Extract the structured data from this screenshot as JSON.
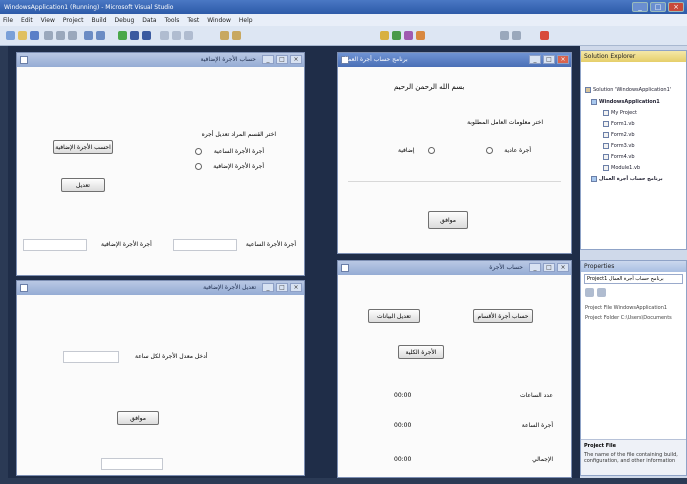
{
  "window": {
    "title": "WindowsApplication1 (Running) - Microsoft Visual Studio"
  },
  "menu": [
    "File",
    "Edit",
    "View",
    "Project",
    "Build",
    "Debug",
    "Data",
    "Tools",
    "Test",
    "Window",
    "Help"
  ],
  "form_top_left": {
    "title": "حساب الأجرة الإضافية",
    "instruction": "اختر القسم المراد تعديل أجره",
    "calc_button": "احسب الأجرة الإضافية",
    "edit_button": "تعديل",
    "radio1": "أجرة الأجرة الساعية",
    "radio2": "أجرة الأجرة الإضافية",
    "label_left": "أجرة الأجرة الإضافية",
    "label_right": "أجرة الأجرة الساعية"
  },
  "form_bottom_left": {
    "title": "تعديل الأجرة الإضافية",
    "prompt": "أدخل معدل الأجرة لكل ساعة",
    "ok_button": "موافق"
  },
  "form_top_right": {
    "title": "برنامج حساب أجرة العمال",
    "bismillah": "بسم الله الرحمن الرحيم",
    "choice_prompt": "اختر معلومات العامل المطلوبة",
    "radio_a": "أجرة عادية",
    "radio_b": "إضافية",
    "ok_button": "موافق"
  },
  "form_bottom_right": {
    "title": "حساب الأجرة",
    "btn_right": "حساب أجرة الأقسام",
    "btn_left": "تعديل البيانات",
    "btn_center": "الأجرة الكلية",
    "row1_label": "عدد الساعات",
    "row1_value": "00:00",
    "row2_label": "أجرة الساعة",
    "row2_value": "00:00",
    "row3_label": "الإجمالي",
    "row3_value": "00:00"
  },
  "solution_explorer": {
    "title": "Solution Explorer",
    "items": [
      "Solution 'WindowsApplication1'",
      "WindowsApplication1",
      "My Project",
      "Form1.vb",
      "Form2.vb",
      "Form3.vb",
      "Form4.vb",
      "Module1.vb",
      "برنامج حساب أجرة العمال"
    ]
  },
  "properties": {
    "title": "Properties",
    "object": "Project1 برنامج حساب أجرة العمال",
    "rows": [
      "Project File  WindowsApplication1",
      "Project Folder  C:\\Users\\Documents"
    ],
    "desc_title": "Project File",
    "desc_text": "The name of the file containing build, configuration, and other information"
  }
}
